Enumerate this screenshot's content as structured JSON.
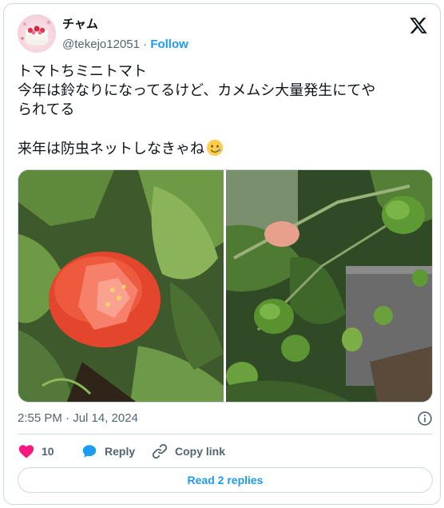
{
  "author": {
    "display_name": "チャム",
    "handle": "@tekejo12051",
    "separator": "·",
    "follow_label": "Follow"
  },
  "tweet": {
    "lines": [
      "トマトちミニトマト",
      "今年は鈴なりになってるけど、カメムシ大量発生にてや",
      "られてる",
      "",
      "来年は防虫ネットしなきゃね"
    ],
    "emoji": "tear-smile-emoji"
  },
  "media": {
    "images": [
      {
        "description_icon": "split-tomato-photo"
      },
      {
        "description_icon": "green-tomatoes-photo"
      }
    ]
  },
  "meta": {
    "timestamp": "2:55 PM · Jul 14, 2024"
  },
  "actions": {
    "like_count": "10",
    "reply_label": "Reply",
    "copy_link_label": "Copy link",
    "read_replies_label": "Read 2 replies"
  },
  "colors": {
    "accent": "#1d9bf0",
    "like": "#f91880",
    "text": "#0f1419",
    "muted": "#536471",
    "border": "#cfd9de"
  }
}
